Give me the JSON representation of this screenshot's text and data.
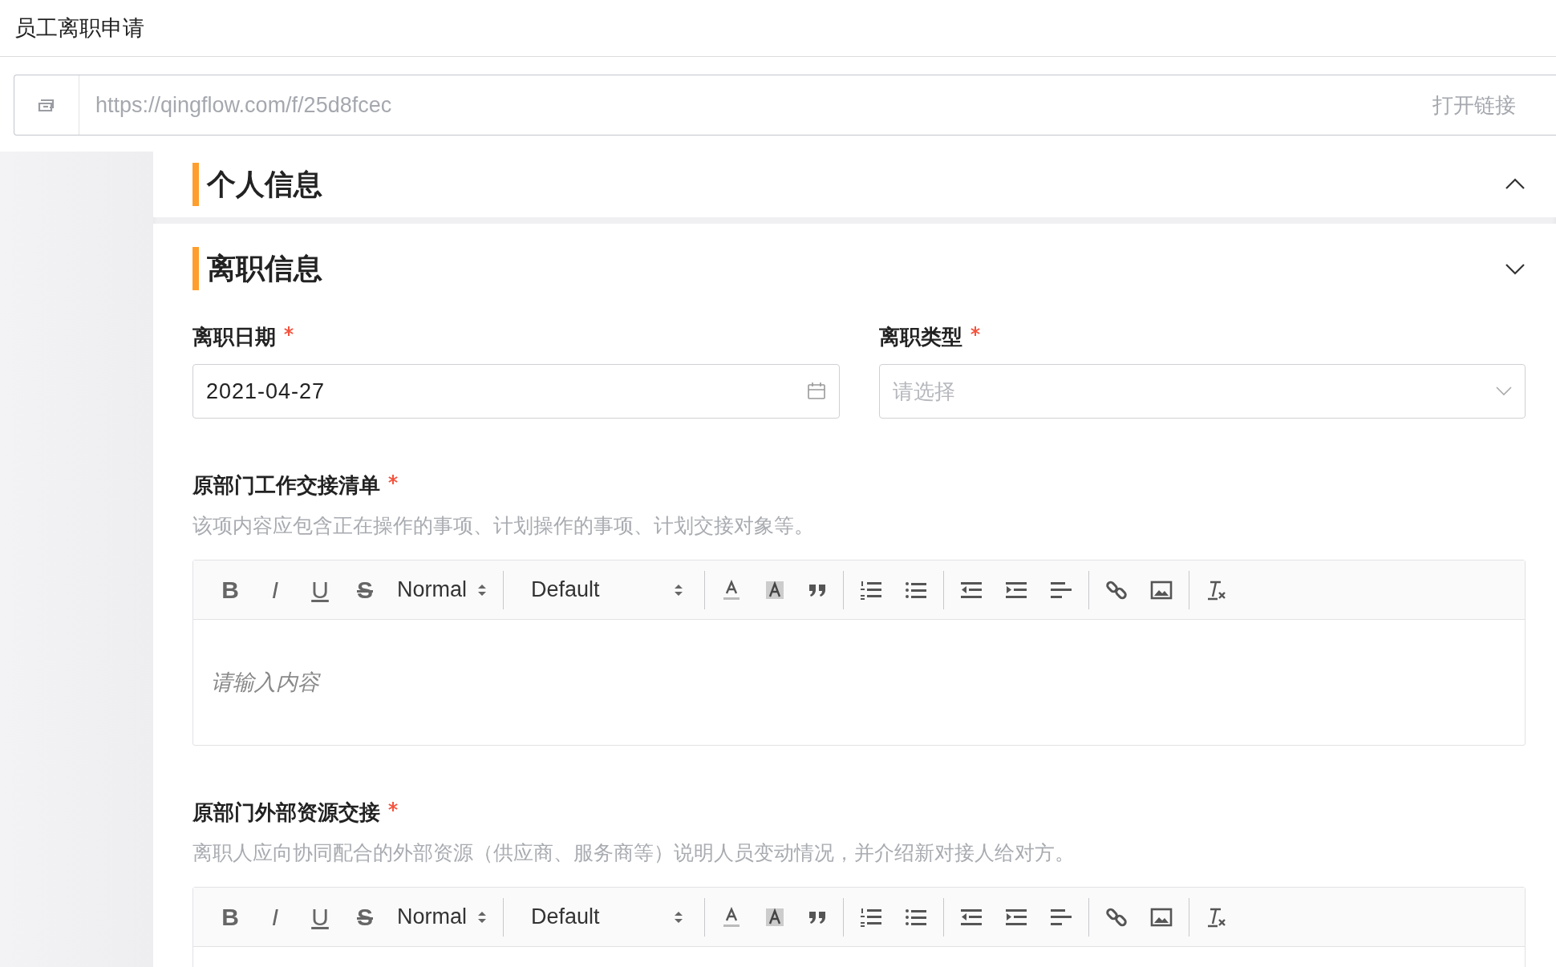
{
  "header": {
    "title": "员工离职申请"
  },
  "link_bar": {
    "url": "https://qingflow.com/f/25d8fcec",
    "action": "打开链接"
  },
  "sections": [
    {
      "title": "个人信息",
      "expanded": false
    },
    {
      "title": "离职信息",
      "expanded": true,
      "fields": [
        {
          "kind": "date",
          "label": "离职日期",
          "required": true,
          "value": "2021-04-27"
        },
        {
          "kind": "select",
          "label": "离职类型",
          "required": true,
          "placeholder": "请选择"
        },
        {
          "kind": "richtext",
          "label": "原部门工作交接清单",
          "required": true,
          "hint": "该项内容应包含正在操作的事项、计划操作的事项、计划交接对象等。",
          "placeholder": "请输入内容",
          "toolbar": [
            {
              "kind": "bold",
              "text": "B"
            },
            {
              "kind": "italic",
              "text": "I"
            },
            {
              "kind": "underline",
              "text": "U"
            },
            {
              "kind": "strike",
              "text": "S"
            },
            {
              "kind": "size",
              "text": "Normal"
            },
            {
              "kind": "sep"
            },
            {
              "kind": "font",
              "text": "Default"
            },
            {
              "kind": "sep"
            },
            {
              "kind": "color"
            },
            {
              "kind": "background"
            },
            {
              "kind": "quote"
            },
            {
              "kind": "sep"
            },
            {
              "kind": "ordered-list"
            },
            {
              "kind": "bullet-list"
            },
            {
              "kind": "sep"
            },
            {
              "kind": "outdent"
            },
            {
              "kind": "indent"
            },
            {
              "kind": "align"
            },
            {
              "kind": "sep"
            },
            {
              "kind": "link"
            },
            {
              "kind": "image"
            },
            {
              "kind": "sep"
            },
            {
              "kind": "clean"
            }
          ]
        },
        {
          "kind": "richtext",
          "label": "原部门外部资源交接",
          "required": true,
          "hint": "离职人应向协同配合的外部资源（供应商、服务商等）说明人员变动情况，并介绍新对接人给对方。",
          "toolbar": [
            {
              "kind": "bold",
              "text": "B"
            },
            {
              "kind": "italic",
              "text": "I"
            },
            {
              "kind": "underline",
              "text": "U"
            },
            {
              "kind": "strike",
              "text": "S"
            },
            {
              "kind": "size",
              "text": "Normal"
            },
            {
              "kind": "sep"
            },
            {
              "kind": "font",
              "text": "Default"
            },
            {
              "kind": "sep"
            },
            {
              "kind": "color"
            },
            {
              "kind": "background"
            },
            {
              "kind": "quote"
            },
            {
              "kind": "sep"
            },
            {
              "kind": "ordered-list"
            },
            {
              "kind": "bullet-list"
            },
            {
              "kind": "sep"
            },
            {
              "kind": "outdent"
            },
            {
              "kind": "indent"
            },
            {
              "kind": "align"
            },
            {
              "kind": "sep"
            },
            {
              "kind": "link"
            },
            {
              "kind": "image"
            },
            {
              "kind": "sep"
            },
            {
              "kind": "clean"
            }
          ]
        }
      ]
    }
  ]
}
